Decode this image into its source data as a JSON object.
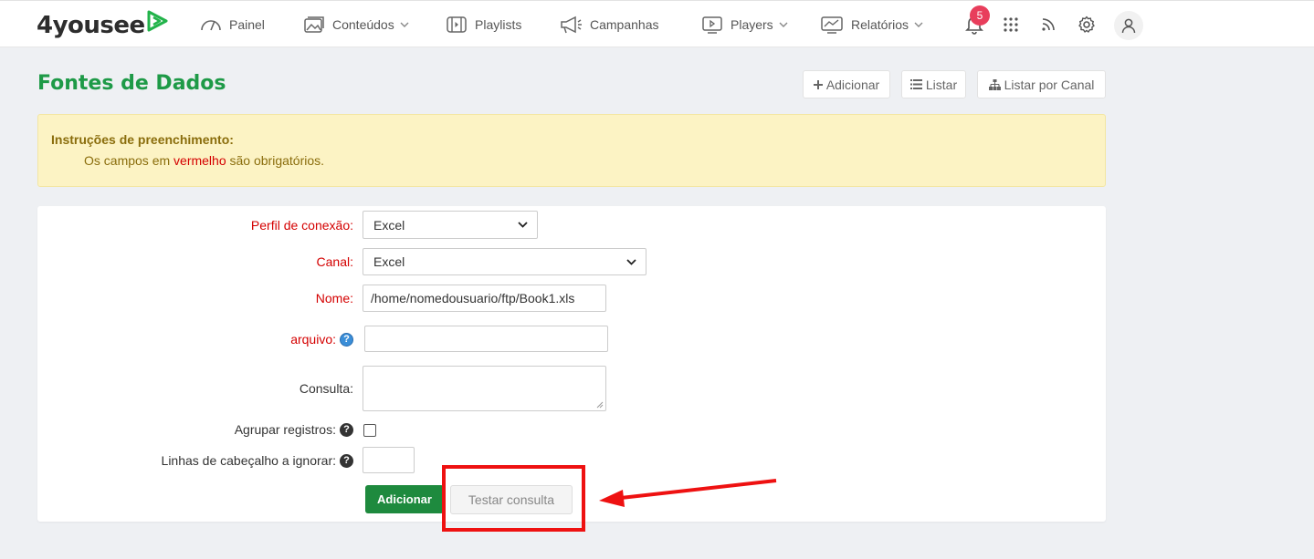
{
  "brand": {
    "name": "4yousee",
    "accent": "#1e9a47"
  },
  "nav": {
    "painel": "Painel",
    "conteudos": "Conteúdos",
    "playlists": "Playlists",
    "campanhas": "Campanhas",
    "players": "Players",
    "relatorios": "Relatórios",
    "notification_count": "5"
  },
  "page": {
    "title": "Fontes de Dados",
    "buttons": {
      "adicionar": "Adicionar",
      "listar": "Listar",
      "listar_canal": "Listar por Canal"
    }
  },
  "alert": {
    "title": "Instruções de preenchimento:",
    "text_before": "Os campos em",
    "text_red": "vermelho",
    "text_after": "são obrigatórios."
  },
  "form": {
    "perfil": {
      "label": "Perfil de conexão:",
      "value": "Excel"
    },
    "canal": {
      "label": "Canal:",
      "value": "Excel"
    },
    "nome": {
      "label": "Nome:",
      "value": "/home/nomedousuario/ftp/Book1.xls"
    },
    "arquivo": {
      "label": "arquivo:",
      "value": ""
    },
    "consulta": {
      "label": "Consulta:",
      "value": ""
    },
    "agrupar": {
      "label": "Agrupar registros:"
    },
    "linhas": {
      "label": "Linhas de cabeçalho a ignorar:",
      "value": ""
    },
    "submit_label": "Adicionar",
    "test_label": "Testar consulta"
  }
}
